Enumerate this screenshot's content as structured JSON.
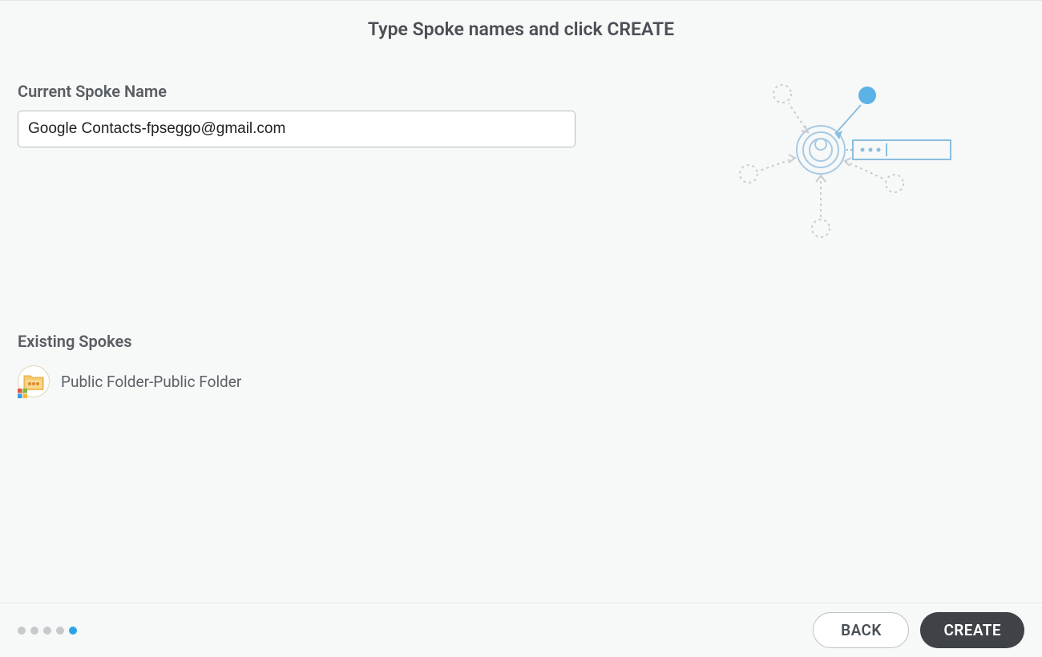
{
  "title": "Type Spoke names and click CREATE",
  "form": {
    "currentSpokeLabel": "Current Spoke Name",
    "currentSpokeValue": "Google Contacts-fpseggo@gmail.com"
  },
  "existing": {
    "label": "Existing Spokes",
    "items": [
      {
        "name": "Public Folder-Public Folder"
      }
    ]
  },
  "footer": {
    "backLabel": "BACK",
    "createLabel": "CREATE",
    "stepCount": 5,
    "activeStep": 5
  }
}
